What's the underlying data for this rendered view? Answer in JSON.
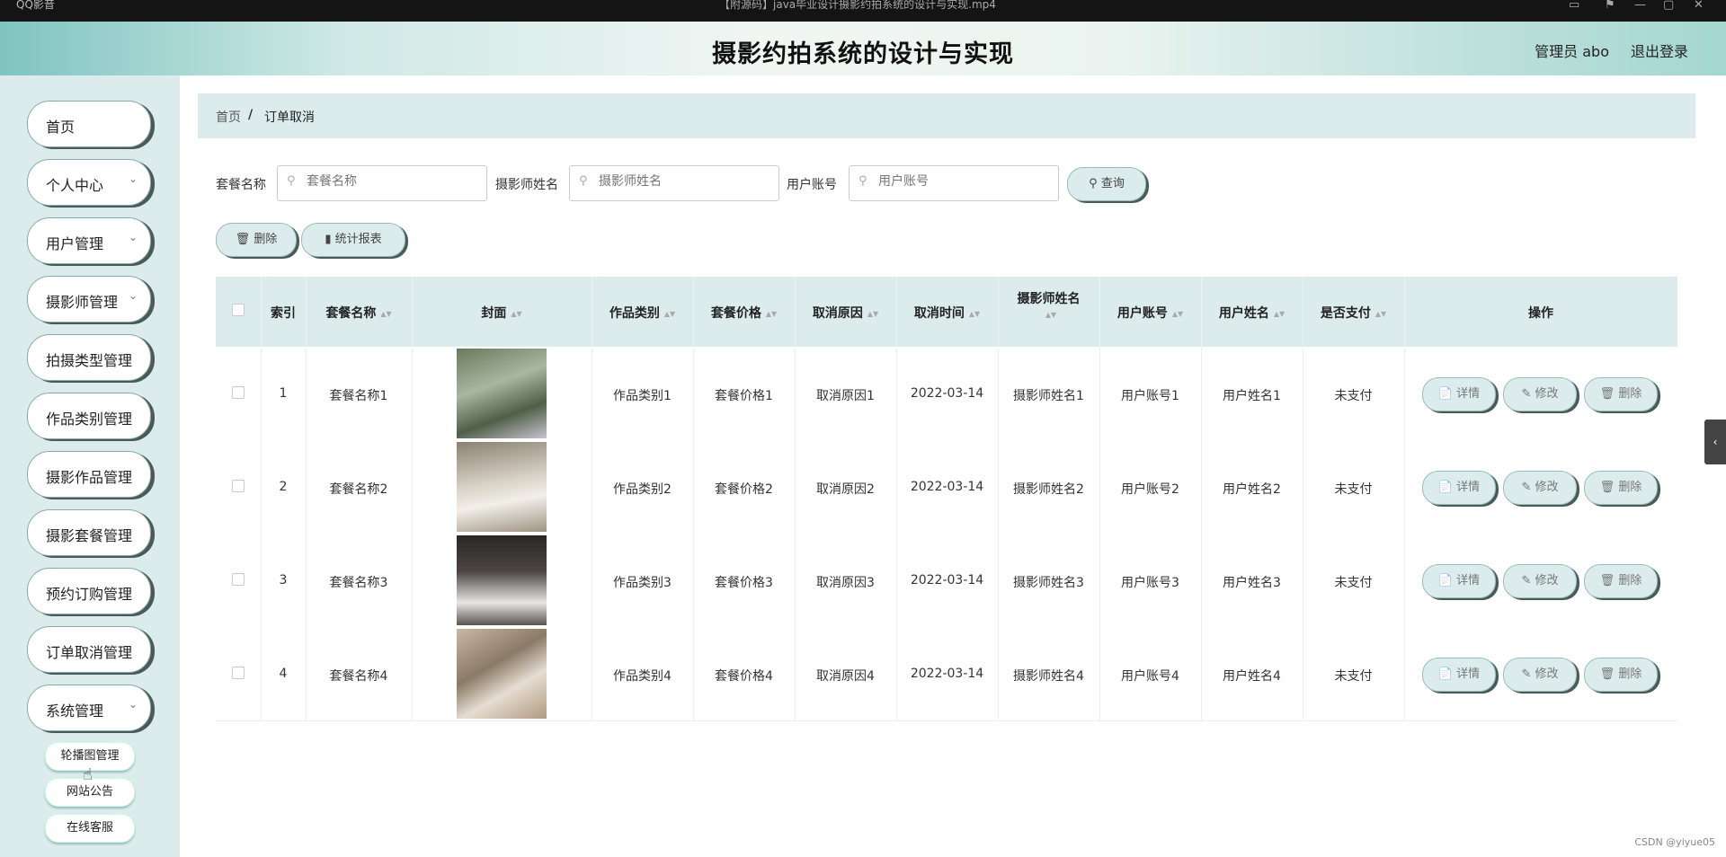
{
  "osbar": {
    "left": "QQ影音",
    "center": "【附源码】java毕业设计摄影约拍系统的设计与实现.mp4"
  },
  "header": {
    "title": "摄影约拍系统的设计与实现",
    "user": "管理员 abo",
    "logout": "退出登录"
  },
  "sidebar": {
    "items": [
      {
        "label": "首页",
        "chevron": false
      },
      {
        "label": "个人中心",
        "chevron": true
      },
      {
        "label": "用户管理",
        "chevron": true
      },
      {
        "label": "摄影师管理",
        "chevron": true
      },
      {
        "label": "拍摄类型管理",
        "chevron": false
      },
      {
        "label": "作品类别管理",
        "chevron": false
      },
      {
        "label": "摄影作品管理",
        "chevron": false
      },
      {
        "label": "摄影套餐管理",
        "chevron": false
      },
      {
        "label": "预约订购管理",
        "chevron": false
      },
      {
        "label": "订单取消管理",
        "chevron": false
      },
      {
        "label": "系统管理",
        "chevron": true
      }
    ],
    "subitems": [
      "轮播图管理",
      "网站公告",
      "在线客服"
    ]
  },
  "breadcrumb": {
    "home": "首页",
    "separator": "/",
    "current": "订单取消"
  },
  "search": {
    "f1_label": "套餐名称",
    "f1_placeholder": "套餐名称",
    "f2_label": "摄影师姓名",
    "f2_placeholder": "摄影师姓名",
    "f3_label": "用户账号",
    "f3_placeholder": "用户账号",
    "query": "查询"
  },
  "toolbar": {
    "delete": "删除",
    "report": "统计报表"
  },
  "table": {
    "headers": {
      "index": "索引",
      "package": "套餐名称",
      "cover": "封面",
      "category": "作品类别",
      "price": "套餐价格",
      "reason": "取消原因",
      "time": "取消时间",
      "photographer": "摄影师姓名",
      "account": "用户账号",
      "username": "用户姓名",
      "paid": "是否支付",
      "ops": "操作"
    },
    "rows": [
      {
        "index": "1",
        "package": "套餐名称1",
        "category": "作品类别1",
        "price": "套餐价格1",
        "reason": "取消原因1",
        "time": "2022-03-14",
        "photographer": "摄影师姓名1",
        "account": "用户账号1",
        "username": "用户姓名1",
        "paid": "未支付"
      },
      {
        "index": "2",
        "package": "套餐名称2",
        "category": "作品类别2",
        "price": "套餐价格2",
        "reason": "取消原因2",
        "time": "2022-03-14",
        "photographer": "摄影师姓名2",
        "account": "用户账号2",
        "username": "用户姓名2",
        "paid": "未支付"
      },
      {
        "index": "3",
        "package": "套餐名称3",
        "category": "作品类别3",
        "price": "套餐价格3",
        "reason": "取消原因3",
        "time": "2022-03-14",
        "photographer": "摄影师姓名3",
        "account": "用户账号3",
        "username": "用户姓名3",
        "paid": "未支付"
      },
      {
        "index": "4",
        "package": "套餐名称4",
        "category": "作品类别4",
        "price": "套餐价格4",
        "reason": "取消原因4",
        "time": "2022-03-14",
        "photographer": "摄影师姓名4",
        "account": "用户账号4",
        "username": "用户姓名4",
        "paid": "未支付"
      }
    ],
    "ops": {
      "detail": "详情",
      "edit": "修改",
      "delete": "删除"
    }
  },
  "watermark": "CSDN @yiyue05",
  "colors": {
    "accent": "#dcecec",
    "shadow": "#4a5a5a"
  }
}
